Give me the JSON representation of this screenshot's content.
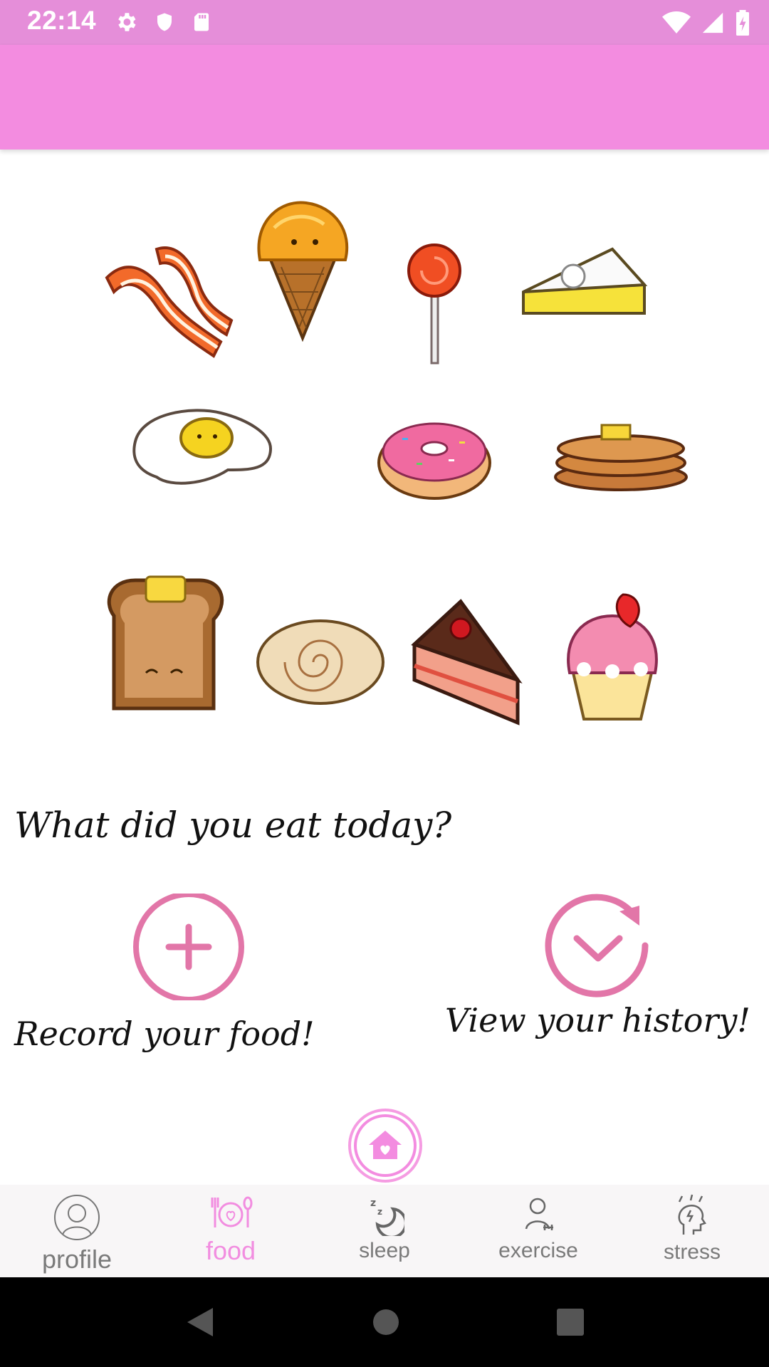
{
  "status_bar": {
    "time": "22:14",
    "left_icons": [
      "gear-icon",
      "shield-icon",
      "sd-card-icon"
    ],
    "right_icons": [
      "wifi-icon",
      "signal-icon",
      "battery-icon"
    ]
  },
  "main": {
    "question": "What did you eat today?",
    "actions": {
      "record_label": "Record your food!",
      "history_label": "View your history!"
    },
    "foods": [
      "bacon",
      "ice-cream-cone",
      "lollipop",
      "pie-slice",
      "fried-egg",
      "donut",
      "pancakes",
      "toast",
      "cinnamon-roll",
      "chocolate-cake-slice",
      "strawberry-cupcake"
    ]
  },
  "bottom_nav": {
    "items": [
      {
        "label": "profile",
        "icon": "profile-icon"
      },
      {
        "label": "food",
        "icon": "food-icon",
        "active": true
      },
      {
        "label": "sleep",
        "icon": "sleep-icon"
      },
      {
        "label": "exercise",
        "icon": "exercise-icon"
      },
      {
        "label": "stress",
        "icon": "stress-icon"
      }
    ]
  },
  "colors": {
    "status_bar": "#e58ed9",
    "app_bar": "#f38ce0",
    "accent": "#f28de0",
    "action_ring": "#e276a8"
  }
}
